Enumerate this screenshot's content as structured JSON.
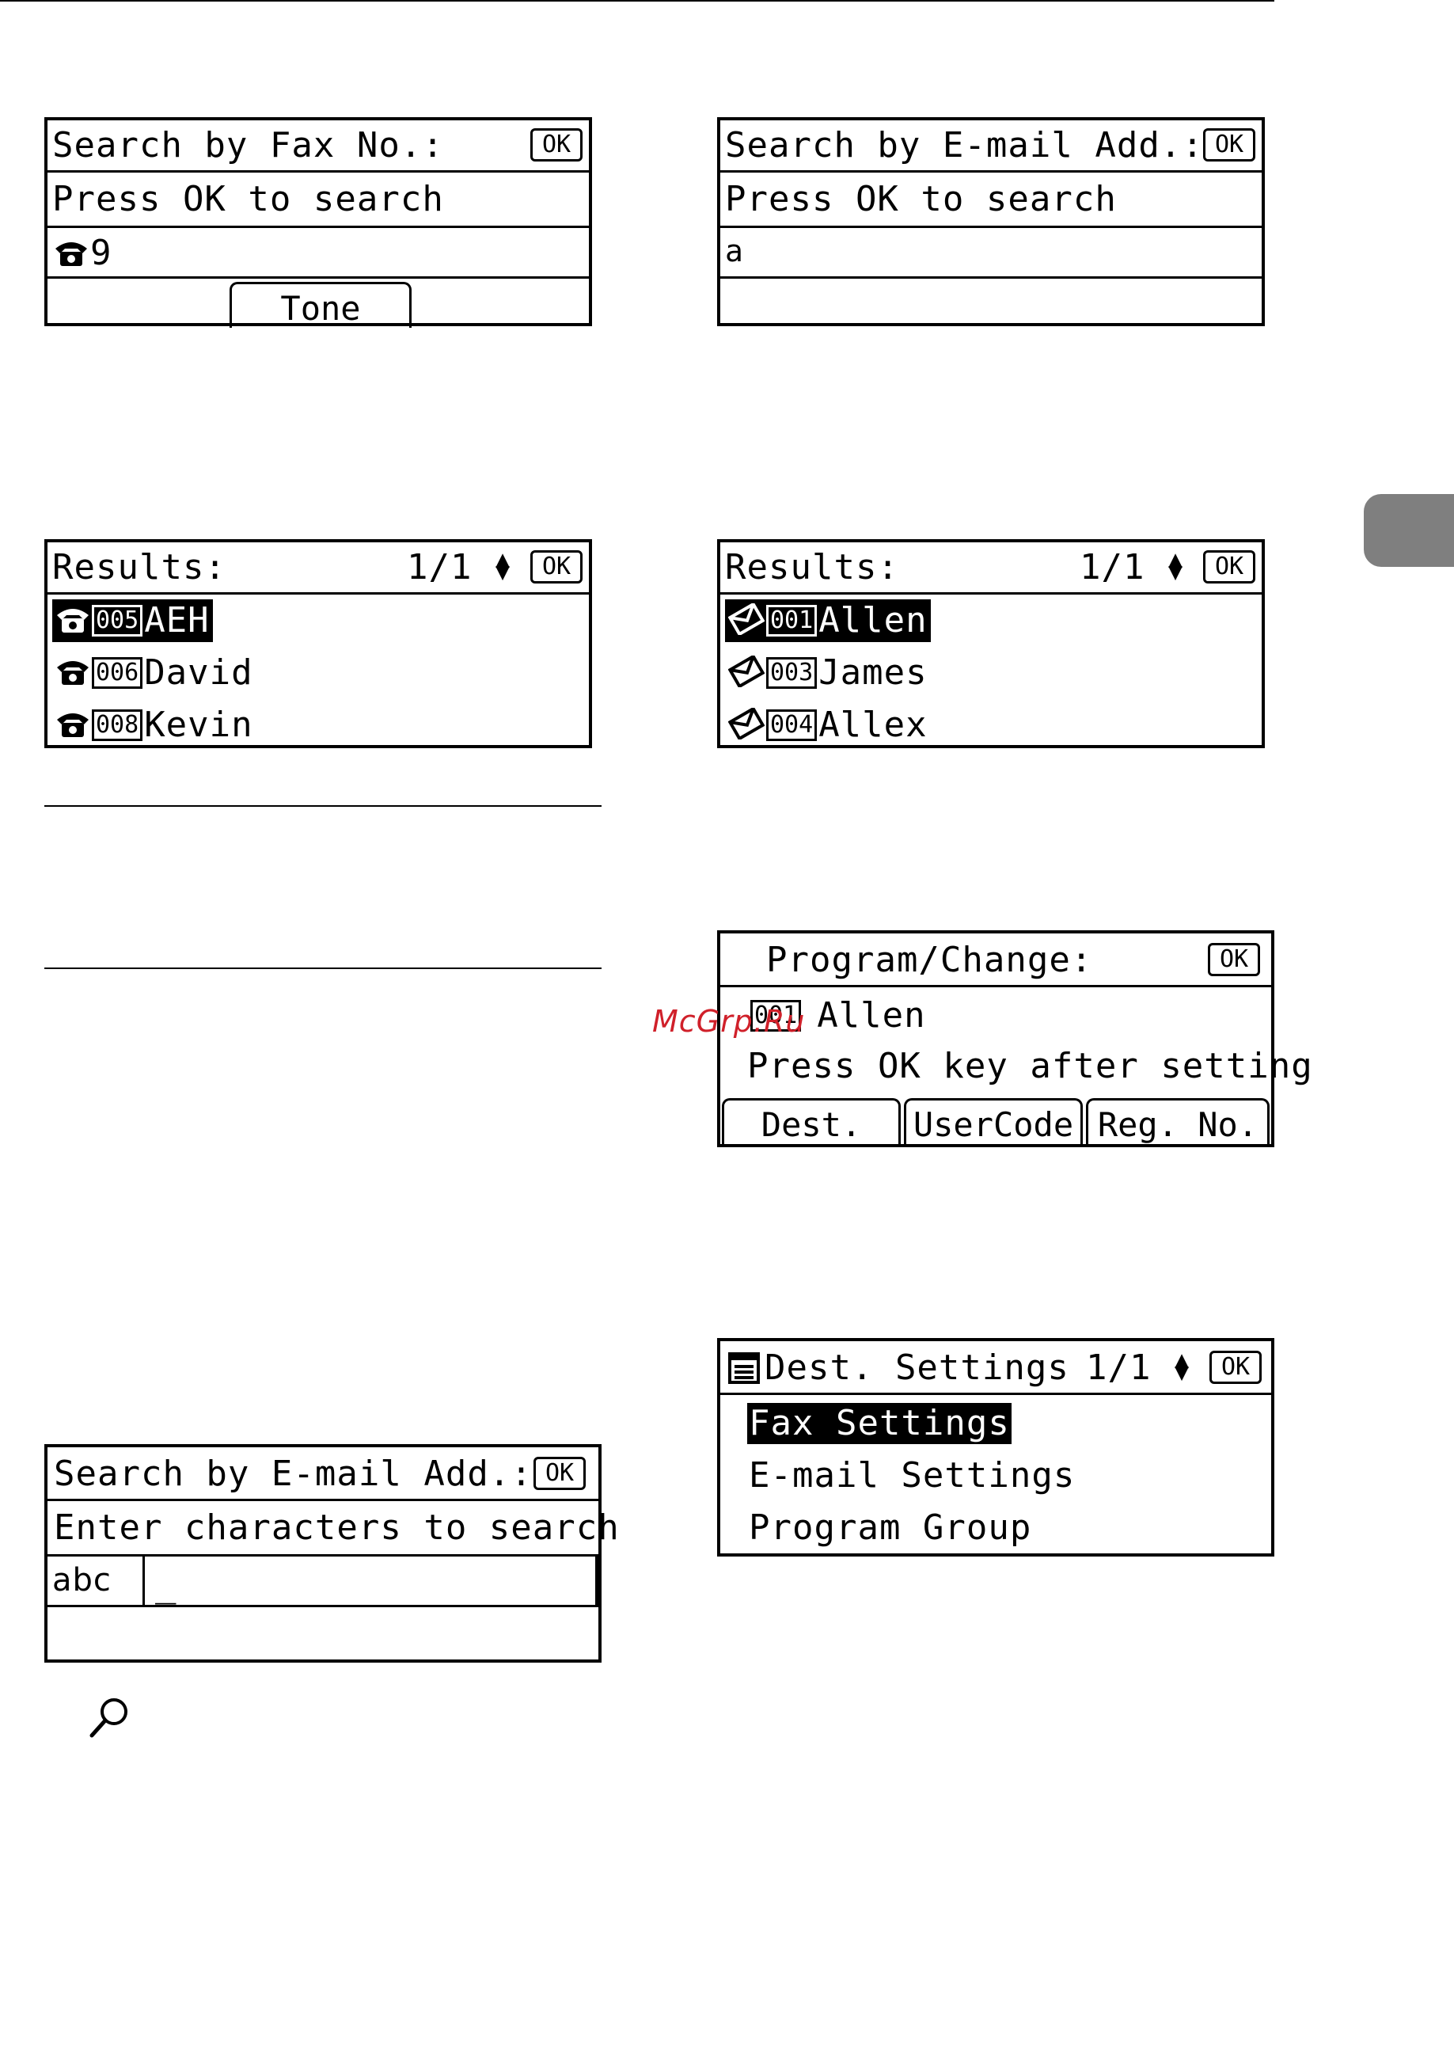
{
  "watermark": "McGrp.Ru",
  "panels": {
    "fax_search": {
      "title": "Search by Fax No.:",
      "ok": "OK",
      "prompt": "Press OK to search",
      "input": "9",
      "softkey": "Tone"
    },
    "email_search_1": {
      "title": "Search by E-mail Add.:",
      "ok": "OK",
      "prompt": "Press OK to search",
      "input": "a"
    },
    "fax_results": {
      "title": "Results:",
      "page": "1/1",
      "ok": "OK",
      "items": [
        {
          "num": "005",
          "name": "AEH",
          "selected": true
        },
        {
          "num": "006",
          "name": "David",
          "selected": false
        },
        {
          "num": "008",
          "name": "Kevin",
          "selected": false
        }
      ]
    },
    "email_results": {
      "title": "Results:",
      "page": "1/1",
      "ok": "OK",
      "items": [
        {
          "num": "001",
          "name": "Allen",
          "selected": true
        },
        {
          "num": "003",
          "name": "James",
          "selected": false
        },
        {
          "num": "004",
          "name": "Allex",
          "selected": false
        }
      ]
    },
    "program_change": {
      "title": "Program/Change:",
      "ok": "OK",
      "num": "001",
      "name": "Allen",
      "message": "Press OK key after setting",
      "softkeys": [
        "Dest.",
        "UserCode",
        "Reg. No."
      ]
    },
    "email_search_2": {
      "title": "Search by E-mail Add.:",
      "ok": "OK",
      "prompt": "Enter characters to search",
      "mode": "abc",
      "cursor": "_"
    },
    "dest_settings": {
      "title": "Dest. Settings",
      "page": "1/1",
      "ok": "OK",
      "items": [
        {
          "label": "Fax Settings",
          "selected": true
        },
        {
          "label": "E-mail Settings",
          "selected": false
        },
        {
          "label": "Program Group",
          "selected": false
        }
      ]
    }
  },
  "icons": {
    "phone": "phone-icon",
    "email": "email-icon",
    "list": "list-icon",
    "magnifier": "magnifier-icon",
    "arrows": "up-down-arrows-icon"
  }
}
